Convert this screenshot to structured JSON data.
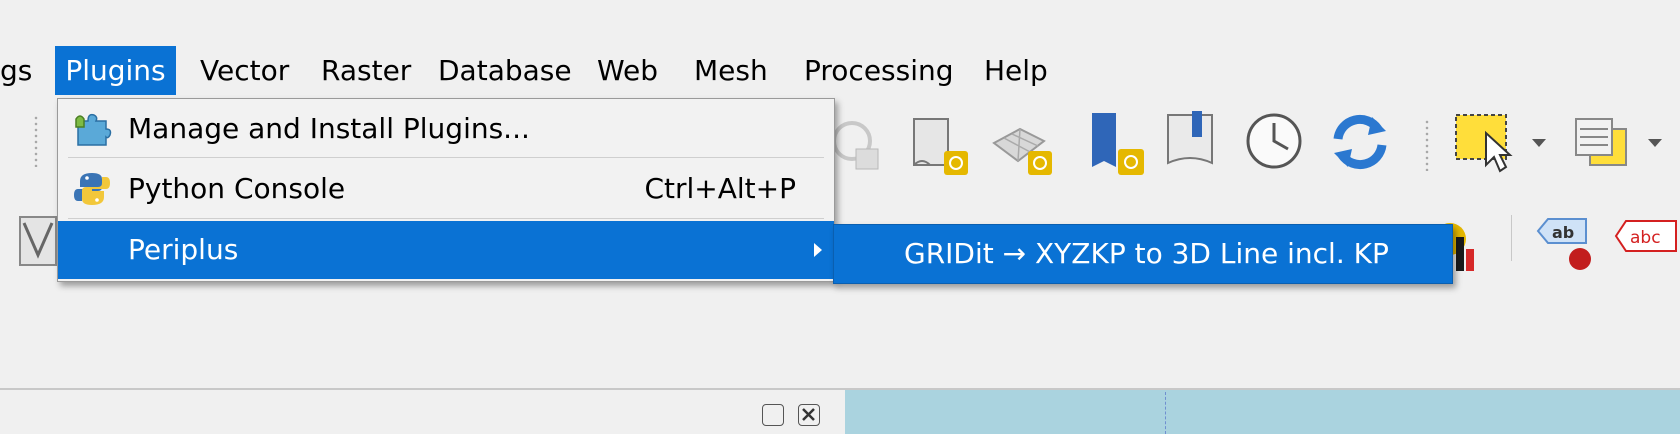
{
  "menubar": {
    "items": [
      {
        "label": "gs"
      },
      {
        "label": "Plugins"
      },
      {
        "label": "Vector"
      },
      {
        "label": "Raster"
      },
      {
        "label": "Database"
      },
      {
        "label": "Web"
      },
      {
        "label": "Mesh"
      },
      {
        "label": "Processing"
      },
      {
        "label": "Help"
      }
    ],
    "active_index": 1
  },
  "plugins_menu": {
    "items": [
      {
        "label": "Manage and Install Plugins...",
        "shortcut": "",
        "icon": "puzzle-piece-icon"
      },
      {
        "label": "Python Console",
        "shortcut": "Ctrl+Alt+P",
        "icon": "python-icon"
      },
      {
        "label": "Periplus",
        "shortcut": "",
        "icon": "",
        "has_submenu": true
      }
    ],
    "selected_index": 2
  },
  "periplus_submenu": {
    "items": [
      {
        "label": "GRIDit → XYZKP to 3D Line incl. KP"
      }
    ]
  },
  "toolbar_labels": {
    "label_tool": "ab",
    "abc_tool": "abc"
  },
  "colors": {
    "menu_highlight": "#0a72d4",
    "map_canvas": "#aad3df"
  }
}
